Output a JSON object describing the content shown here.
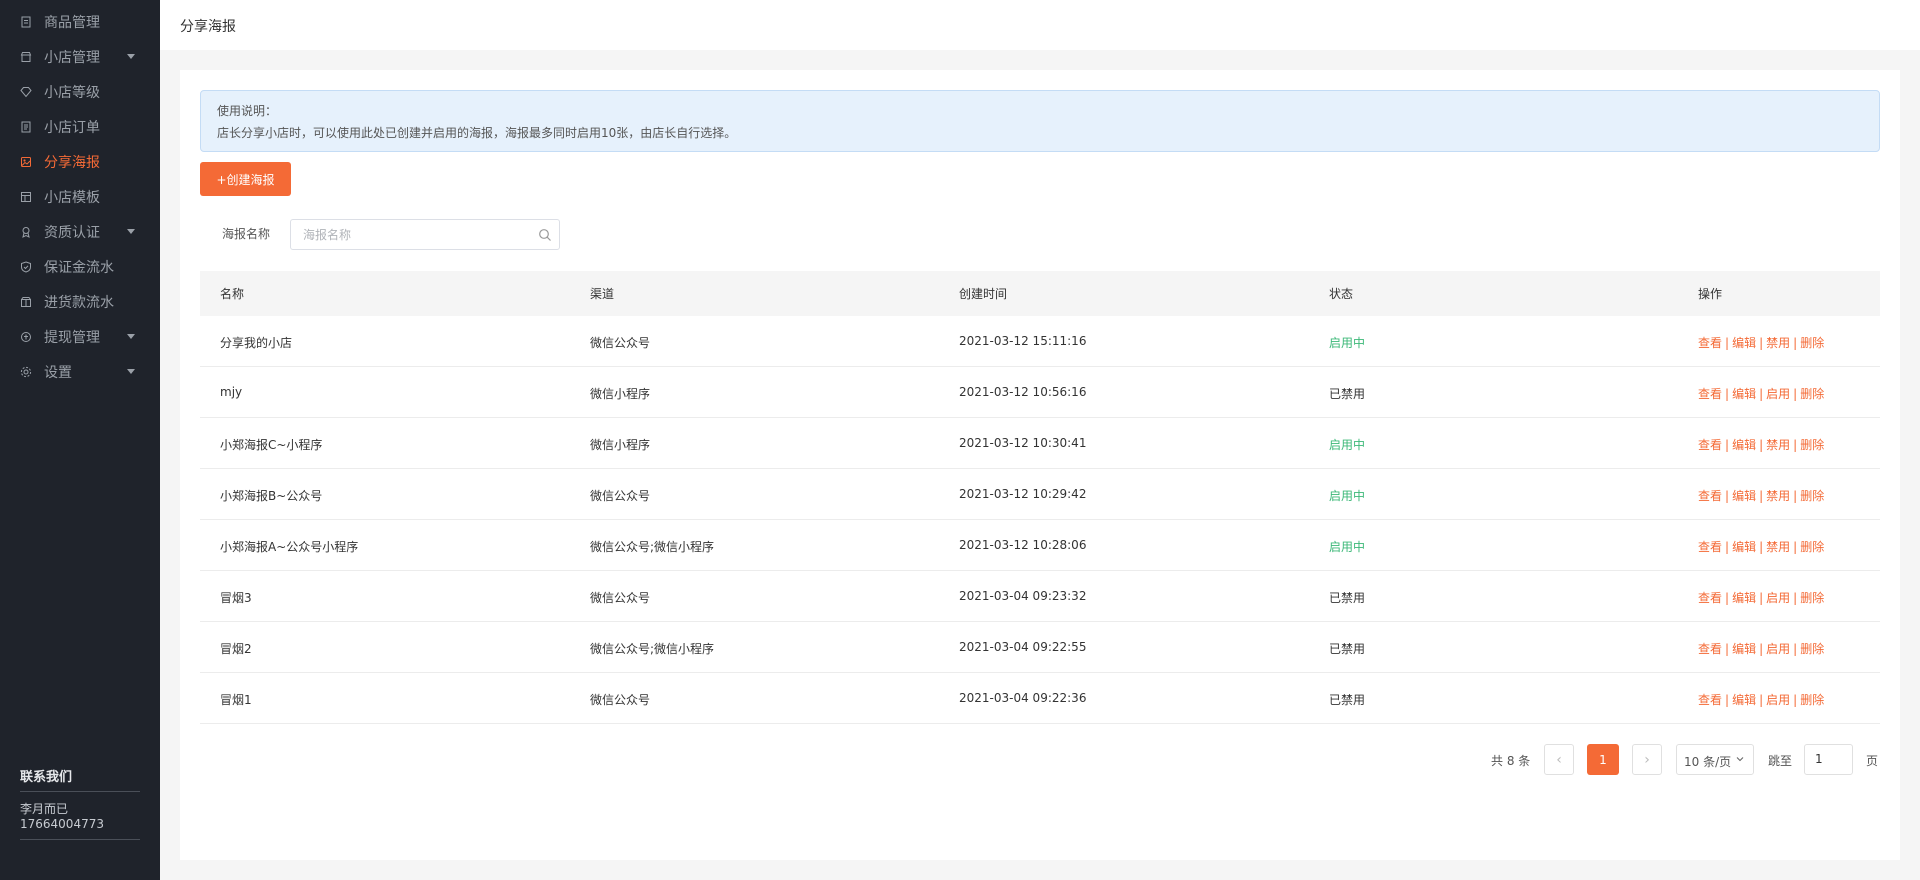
{
  "sidebar": {
    "items": [
      {
        "label": "商品管理",
        "icon": "document-icon",
        "has_caret": false,
        "active": false
      },
      {
        "label": "小店管理",
        "icon": "shop-icon",
        "has_caret": true,
        "active": false
      },
      {
        "label": "小店等级",
        "icon": "diamond-icon",
        "has_caret": false,
        "active": false
      },
      {
        "label": "小店订单",
        "icon": "order-icon",
        "has_caret": false,
        "active": false
      },
      {
        "label": "分享海报",
        "icon": "poster-icon",
        "has_caret": false,
        "active": true
      },
      {
        "label": "小店模板",
        "icon": "template-icon",
        "has_caret": false,
        "active": false
      },
      {
        "label": "资质认证",
        "icon": "certificate-icon",
        "has_caret": true,
        "active": false
      },
      {
        "label": "保证金流水",
        "icon": "shield-icon",
        "has_caret": false,
        "active": false
      },
      {
        "label": "进货款流水",
        "icon": "box-icon",
        "has_caret": false,
        "active": false
      },
      {
        "label": "提现管理",
        "icon": "withdraw-icon",
        "has_caret": true,
        "active": false
      },
      {
        "label": "设置",
        "icon": "gear-icon",
        "has_caret": true,
        "active": false
      }
    ],
    "contact": {
      "title": "联系我们",
      "name": "李月而已",
      "phone": "17664004773"
    }
  },
  "header": {
    "title": "分享海报"
  },
  "notice": {
    "title": "使用说明：",
    "text": "店长分享小店时，可以使用此处已创建并启用的海报，海报最多同时启用10张，由店长自行选择。"
  },
  "toolbar": {
    "create_label": "+创建海报"
  },
  "filter": {
    "label": "海报名称",
    "placeholder": "海报名称",
    "value": ""
  },
  "table": {
    "columns": [
      "名称",
      "渠道",
      "创建时间",
      "状态",
      "操作"
    ],
    "rows": [
      {
        "name": "分享我的小店",
        "channel": "微信公众号",
        "created": "2021-03-12 15:11:16",
        "status": "启用中",
        "enabled": true,
        "toggle": "禁用"
      },
      {
        "name": "mjy",
        "channel": "微信小程序",
        "created": "2021-03-12 10:56:16",
        "status": "已禁用",
        "enabled": false,
        "toggle": "启用"
      },
      {
        "name": "小郑海报C~小程序",
        "channel": "微信小程序",
        "created": "2021-03-12 10:30:41",
        "status": "启用中",
        "enabled": true,
        "toggle": "禁用"
      },
      {
        "name": "小郑海报B~公众号",
        "channel": "微信公众号",
        "created": "2021-03-12 10:29:42",
        "status": "启用中",
        "enabled": true,
        "toggle": "禁用"
      },
      {
        "name": "小郑海报A~公众号小程序",
        "channel": "微信公众号;微信小程序",
        "created": "2021-03-12 10:28:06",
        "status": "启用中",
        "enabled": true,
        "toggle": "禁用"
      },
      {
        "name": "冒烟3",
        "channel": "微信公众号",
        "created": "2021-03-04 09:23:32",
        "status": "已禁用",
        "enabled": false,
        "toggle": "启用"
      },
      {
        "name": "冒烟2",
        "channel": "微信公众号;微信小程序",
        "created": "2021-03-04 09:22:55",
        "status": "已禁用",
        "enabled": false,
        "toggle": "启用"
      },
      {
        "name": "冒烟1",
        "channel": "微信公众号",
        "created": "2021-03-04 09:22:36",
        "status": "已禁用",
        "enabled": false,
        "toggle": "启用"
      }
    ],
    "actions": {
      "view": "查看",
      "edit": "编辑",
      "delete": "删除",
      "separator": "|"
    }
  },
  "pagination": {
    "total_text": "共 8 条",
    "current_page": "1",
    "page_size": "10 条/页",
    "jump_label": "跳至",
    "jump_value": "1",
    "page_label": "页",
    "prev_glyph": "‹",
    "next_glyph": "›"
  },
  "colors": {
    "accent": "#f46a36",
    "status_on": "#3cb878",
    "sidebar_bg": "#1f232b"
  }
}
